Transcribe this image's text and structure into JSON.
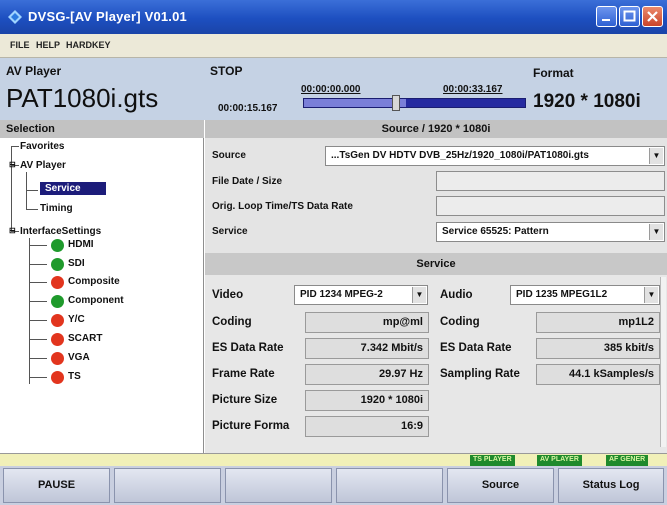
{
  "window": {
    "title": "DVSG-[AV Player]  V01.01",
    "icon": "diamond-app-icon",
    "controls": [
      "minimize-icon",
      "maximize-icon",
      "close-icon"
    ]
  },
  "menu": [
    "FILE",
    "HELP",
    "HARDKEY"
  ],
  "header": {
    "label": "AV Player",
    "filename": "PAT1080i.gts",
    "state": "STOP",
    "time_current": "00:00:15.167",
    "time_start": "00:00:00.000",
    "time_end": "00:00:33.167",
    "format_label": "Format",
    "format_value": "1920 * 1080i",
    "progress_fraction": 0.46
  },
  "selection": {
    "title": "Selection",
    "items": {
      "favorites": "Favorites",
      "av_player": "AV Player",
      "service": "Service",
      "timing": "Timing",
      "interface_settings": "InterfaceSettings",
      "hdmi": "HDMI",
      "sdi": "SDI",
      "composite": "Composite",
      "component": "Component",
      "yc": "Y/C",
      "scart": "SCART",
      "vga": "VGA",
      "ts": "TS"
    }
  },
  "source": {
    "title": "Source / 1920 * 1080i",
    "source_label": "Source",
    "source_value": "...TsGen DV HDTV DVB_25Hz/1920_1080i/PAT1080i.gts",
    "file_date_label": "File Date / Size",
    "loop_label": "Orig. Loop Time/TS Data Rate",
    "service_label": "Service",
    "service_value": "Service 65525: Pattern"
  },
  "service": {
    "title": "Service",
    "video_label": "Video",
    "video_pid": "PID 1234 MPEG-2",
    "audio_label": "Audio",
    "audio_pid": "PID 1235 MPEG1L2",
    "video_rows": [
      {
        "label": "Coding",
        "value": "mp@ml"
      },
      {
        "label": "ES Data Rate",
        "value": "7.342 Mbit/s"
      },
      {
        "label": "Frame Rate",
        "value": "29.97 Hz"
      },
      {
        "label": "Picture Size",
        "value": "1920 * 1080i"
      },
      {
        "label": "Picture Forma",
        "value": "16:9"
      }
    ],
    "audio_rows": [
      {
        "label": "Coding",
        "value": "mp1L2"
      },
      {
        "label": "ES Data Rate",
        "value": "385 kbit/s"
      },
      {
        "label": "Sampling Rate",
        "value": "44.1 kSamples/s"
      }
    ]
  },
  "status_badges": [
    "TS PLAYER",
    "AV PLAYER",
    "AF GENER"
  ],
  "softkeys": [
    "PAUSE",
    "",
    "",
    "",
    "Source",
    "Status Log"
  ],
  "colors": {
    "titlebar": "#1d4fc0",
    "header_bg": "#c5d2e4",
    "progress": "#252aa0",
    "active_dot": "#1f9a2c",
    "inactive_dot": "#e2351e",
    "selected_item": "#1c1c7a",
    "status_badge": "#1f8a2c"
  }
}
